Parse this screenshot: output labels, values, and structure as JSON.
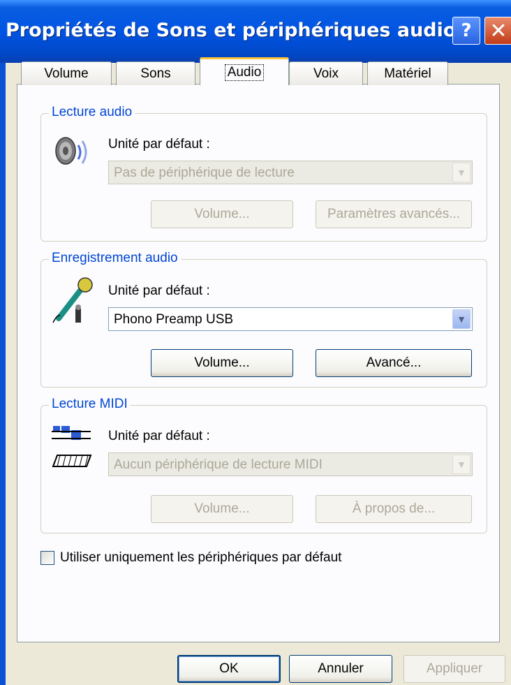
{
  "window": {
    "title": "Propriétés de Sons et périphériques audio",
    "help_label": "?",
    "close_label": "✕"
  },
  "tabs": [
    {
      "label": "Volume",
      "active": false
    },
    {
      "label": "Sons",
      "active": false
    },
    {
      "label": "Audio",
      "active": true
    },
    {
      "label": "Voix",
      "active": false
    },
    {
      "label": "Matériel",
      "active": false
    }
  ],
  "playback": {
    "title": "Lecture audio",
    "device_label": "Unité par défaut :",
    "device_value": "Pas de périphérique de lecture",
    "volume_button": "Volume...",
    "advanced_button": "Paramètres avancés...",
    "icon": "speaker-icon",
    "enabled": false
  },
  "recording": {
    "title": "Enregistrement audio",
    "device_label": "Unité par défaut :",
    "device_value": "Phono Preamp USB",
    "volume_button": "Volume...",
    "advanced_button": "Avancé...",
    "icon": "microphone-icon",
    "enabled": true
  },
  "midi": {
    "title": "Lecture MIDI",
    "device_label": "Unité par défaut :",
    "device_value": "Aucun périphérique de lecture MIDI",
    "volume_button": "Volume...",
    "about_button": "À propos de...",
    "icon": "midi-keyboard-icon",
    "enabled": false
  },
  "default_only": {
    "label": "Utiliser uniquement les périphériques par défaut",
    "checked": false
  },
  "footer": {
    "ok": "OK",
    "cancel": "Annuler",
    "apply": "Appliquer"
  },
  "colors": {
    "titlebar": "#0054e3",
    "group_title": "#0046d5",
    "disabled_text": "#aca899",
    "dialog_bg": "#ece9d8"
  }
}
